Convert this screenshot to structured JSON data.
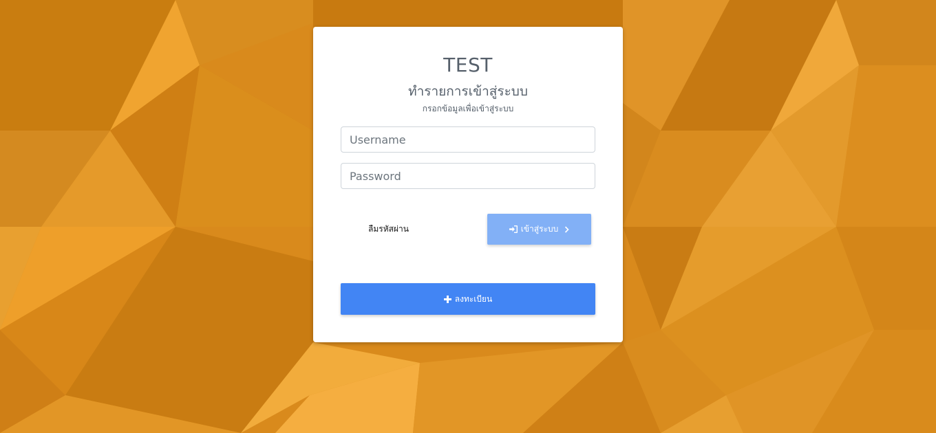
{
  "background": {
    "base_color": "#d98a1c",
    "pattern": "low-poly-triangles"
  },
  "login_card": {
    "title": "TEST",
    "subtitle": "ทำรายการเข้าสู่ระบบ",
    "hint": "กรอกข้อมูลเพื่อเข้าสู่ระบบ",
    "username": {
      "placeholder": "Username",
      "value": ""
    },
    "password": {
      "placeholder": "Password",
      "value": ""
    },
    "forgot_password_label": "ลืมรหัสผ่าน",
    "login_button": {
      "label": "เข้าสู่ระบบ",
      "icon": "sign-in-icon",
      "trailing_icon": "chevron-right-icon",
      "color": "#82b0f6"
    },
    "register_button": {
      "label": "ลงทะเบียน",
      "icon": "plus-icon",
      "color": "#4285f4"
    }
  }
}
